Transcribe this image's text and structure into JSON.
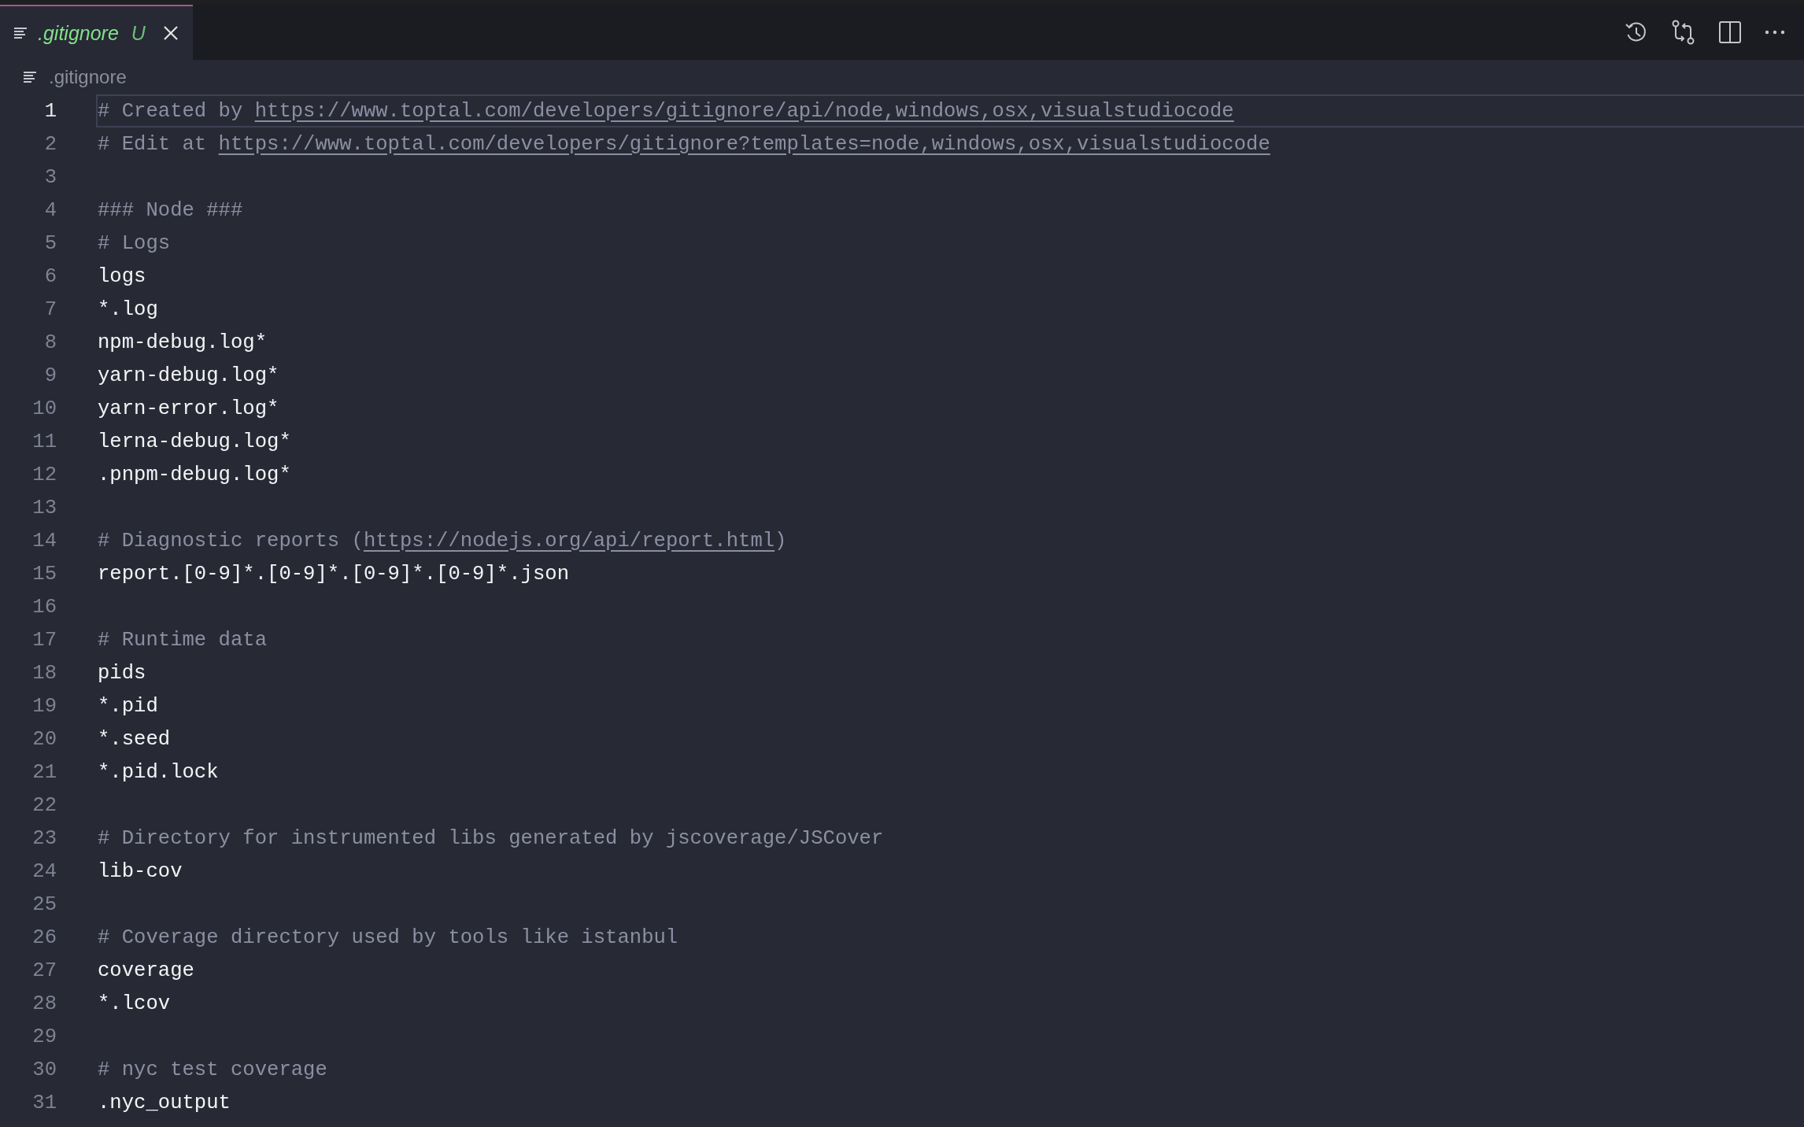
{
  "tabs": [
    {
      "label": ".gitignore",
      "status": "U",
      "selected": true
    }
  ],
  "breadcrumb": {
    "label": ".gitignore"
  },
  "editor": {
    "lines": [
      {
        "number": "1",
        "current": true,
        "parts": [
          {
            "kind": "comment",
            "text": "# Created by "
          },
          {
            "kind": "link",
            "text": "https://www.toptal.com/developers/gitignore/api/node,windows,osx,visualstudiocode"
          }
        ]
      },
      {
        "number": "2",
        "current": false,
        "parts": [
          {
            "kind": "comment",
            "text": "# Edit at "
          },
          {
            "kind": "link",
            "text": "https://www.toptal.com/developers/gitignore?templates=node,windows,osx,visualstudiocode"
          }
        ]
      },
      {
        "number": "3",
        "current": false
      },
      {
        "number": "4",
        "current": false,
        "parts": [
          {
            "kind": "comment",
            "text": "### Node ###"
          }
        ]
      },
      {
        "number": "5",
        "current": false,
        "parts": [
          {
            "kind": "comment",
            "text": "# Logs"
          }
        ]
      },
      {
        "number": "6",
        "current": false,
        "parts": [
          {
            "kind": "pattern",
            "text": "logs"
          }
        ]
      },
      {
        "number": "7",
        "current": false,
        "parts": [
          {
            "kind": "pattern",
            "text": "*.log"
          }
        ]
      },
      {
        "number": "8",
        "current": false,
        "parts": [
          {
            "kind": "pattern",
            "text": "npm-debug.log*"
          }
        ]
      },
      {
        "number": "9",
        "current": false,
        "parts": [
          {
            "kind": "pattern",
            "text": "yarn-debug.log*"
          }
        ]
      },
      {
        "number": "10",
        "current": false,
        "parts": [
          {
            "kind": "pattern",
            "text": "yarn-error.log*"
          }
        ]
      },
      {
        "number": "11",
        "current": false,
        "parts": [
          {
            "kind": "pattern",
            "text": "lerna-debug.log*"
          }
        ]
      },
      {
        "number": "12",
        "current": false,
        "parts": [
          {
            "kind": "pattern",
            "text": ".pnpm-debug.log*"
          }
        ]
      },
      {
        "number": "13",
        "current": false
      },
      {
        "number": "14",
        "current": false,
        "parts": [
          {
            "kind": "comment",
            "text": "# Diagnostic reports ("
          },
          {
            "kind": "link",
            "text": "https://nodejs.org/api/report.html"
          },
          {
            "kind": "comment",
            "text": ")"
          }
        ]
      },
      {
        "number": "15",
        "current": false,
        "parts": [
          {
            "kind": "pattern",
            "text": "report.[0-9]*.[0-9]*.[0-9]*.[0-9]*.json"
          }
        ]
      },
      {
        "number": "16",
        "current": false
      },
      {
        "number": "17",
        "current": false,
        "parts": [
          {
            "kind": "comment",
            "text": "# Runtime data"
          }
        ]
      },
      {
        "number": "18",
        "current": false,
        "parts": [
          {
            "kind": "pattern",
            "text": "pids"
          }
        ]
      },
      {
        "number": "19",
        "current": false,
        "parts": [
          {
            "kind": "pattern",
            "text": "*.pid"
          }
        ]
      },
      {
        "number": "20",
        "current": false,
        "parts": [
          {
            "kind": "pattern",
            "text": "*.seed"
          }
        ]
      },
      {
        "number": "21",
        "current": false,
        "parts": [
          {
            "kind": "pattern",
            "text": "*.pid.lock"
          }
        ]
      },
      {
        "number": "22",
        "current": false
      },
      {
        "number": "23",
        "current": false,
        "parts": [
          {
            "kind": "comment",
            "text": "# Directory for instrumented libs generated by jscoverage/JSCover"
          }
        ]
      },
      {
        "number": "24",
        "current": false,
        "parts": [
          {
            "kind": "pattern",
            "text": "lib-cov"
          }
        ]
      },
      {
        "number": "25",
        "current": false
      },
      {
        "number": "26",
        "current": false,
        "parts": [
          {
            "kind": "comment",
            "text": "# Coverage directory used by tools like istanbul"
          }
        ]
      },
      {
        "number": "27",
        "current": false,
        "parts": [
          {
            "kind": "pattern",
            "text": "coverage"
          }
        ]
      },
      {
        "number": "28",
        "current": false,
        "parts": [
          {
            "kind": "pattern",
            "text": "*.lcov"
          }
        ]
      },
      {
        "number": "29",
        "current": false
      },
      {
        "number": "30",
        "current": false,
        "parts": [
          {
            "kind": "comment",
            "text": "# nyc test coverage"
          }
        ]
      },
      {
        "number": "31",
        "current": false,
        "parts": [
          {
            "kind": "pattern",
            "text": ".nyc_output"
          }
        ]
      }
    ]
  }
}
